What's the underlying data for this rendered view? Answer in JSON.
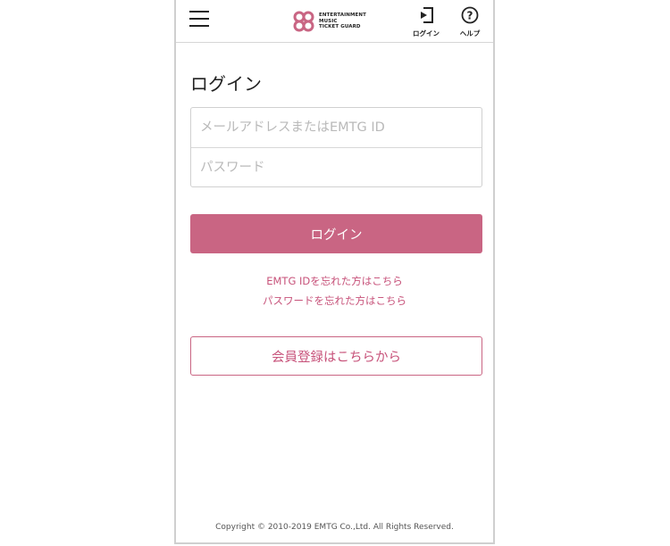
{
  "header": {
    "logo_lines": [
      "ENTERTAINMENT",
      "MUSIC",
      "TICKET GUARD"
    ],
    "login_label": "ログイン",
    "help_label": "ヘルプ",
    "brand_color": "#c96583"
  },
  "main": {
    "title": "ログイン",
    "email_placeholder": "メールアドレスまたはEMTG ID",
    "password_placeholder": "パスワード",
    "login_button": "ログイン",
    "forgot_id_link": "EMTG IDを忘れた方はこちら",
    "forgot_password_link": "パスワードを忘れた方はこちら",
    "register_button": "会員登録はこちらから"
  },
  "footer": {
    "copyright": "Copyright © 2010-2019 EMTG Co.,Ltd. All Rights Reserved."
  },
  "icons": {
    "menu": "hamburger-menu-icon",
    "logo": "emtg-logo-icon",
    "login": "login-icon",
    "help": "help-icon"
  }
}
